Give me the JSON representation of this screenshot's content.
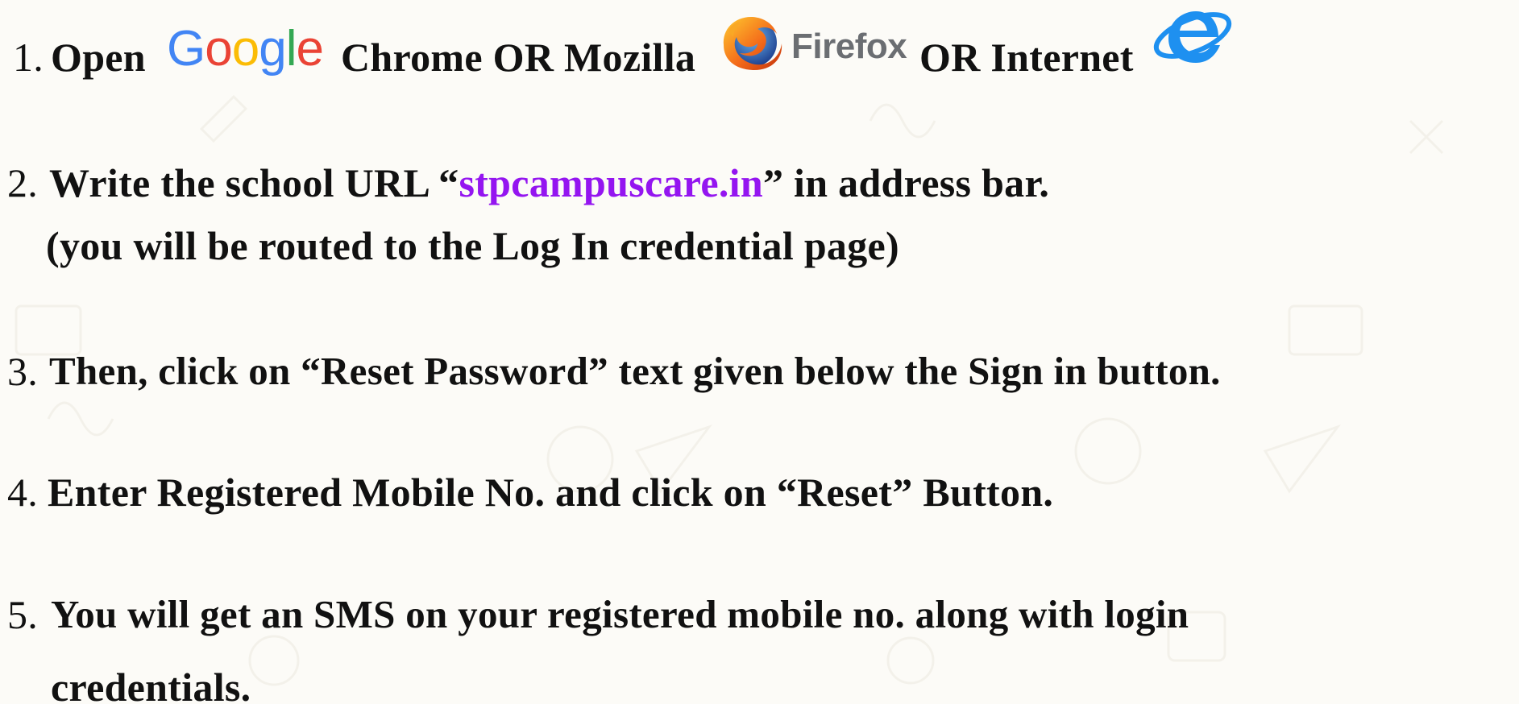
{
  "colors": {
    "background": "#fcfbf7",
    "text": "#111111",
    "url": "#9415f0",
    "google_blue": "#4285f4",
    "google_red": "#ea4335",
    "google_yellow": "#fbbc05",
    "google_green": "#34a853",
    "firefox_gray": "#6b6e72",
    "ie_blue": "#1e90f0"
  },
  "logos": {
    "google": {
      "icon": "google-wordmark",
      "letters": [
        "G",
        "o",
        "o",
        "g",
        "l",
        "e"
      ]
    },
    "firefox": {
      "icon": "firefox-icon",
      "wordmark": "Firefox"
    },
    "internet_explorer": {
      "icon": "internet-explorer-icon"
    }
  },
  "steps": [
    {
      "number": "1.",
      "parts": [
        "Open",
        "Chrome OR Mozilla",
        "OR Internet"
      ]
    },
    {
      "number": "2.",
      "before_url": "Write the school URL “",
      "url": "stpcampuscare.in",
      "after_url": "” in address bar.",
      "note": "(you will be routed to the Log In credential page)"
    },
    {
      "number": "3.",
      "text": "Then, click on “Reset Password” text given below the Sign in button."
    },
    {
      "number": "4.",
      "text": "Enter Registered Mobile No. and click on “Reset” Button."
    },
    {
      "number": "5.",
      "text": "You will get an SMS on your registered mobile no. along with login",
      "continuation": "credentials."
    }
  ]
}
